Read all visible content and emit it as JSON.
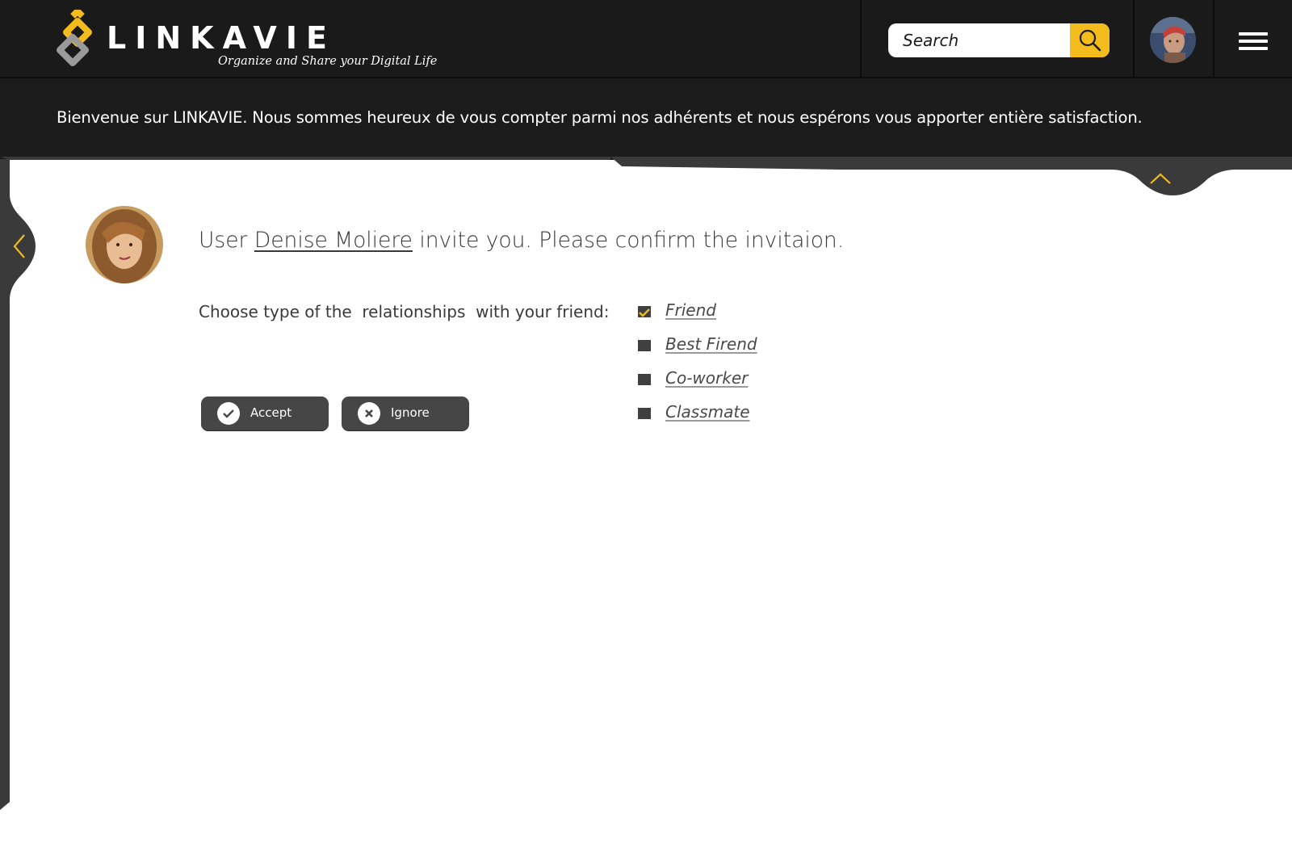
{
  "brand": {
    "name": "LINKAVIE",
    "tagline": "Organize and Share your Digital Life",
    "accent_color": "#F3BB1C",
    "dark_color": "#1A1A1A"
  },
  "header": {
    "search": {
      "placeholder": "Search",
      "value": ""
    },
    "search_icon": "search-icon",
    "menu_icon": "hamburger-menu-icon"
  },
  "banner": {
    "text": "Bienvenue sur LINKAVIE. Nous sommes heureux de vous compter parmi nos adhérents et nous espérons vous apporter entière satisfaction."
  },
  "invitation": {
    "prefix": "User ",
    "user_name": "Denise Moliere",
    "suffix": " invite you. Please confirm the invitaion.",
    "choose_label": "Choose type of the  relationships  with your friend:",
    "options": [
      {
        "label": "Friend",
        "checked": true
      },
      {
        "label": "Best Firend",
        "checked": false
      },
      {
        "label": "Co-worker",
        "checked": false
      },
      {
        "label": "Classmate",
        "checked": false
      }
    ],
    "accept_label": "Accept",
    "ignore_label": "Ignore"
  }
}
